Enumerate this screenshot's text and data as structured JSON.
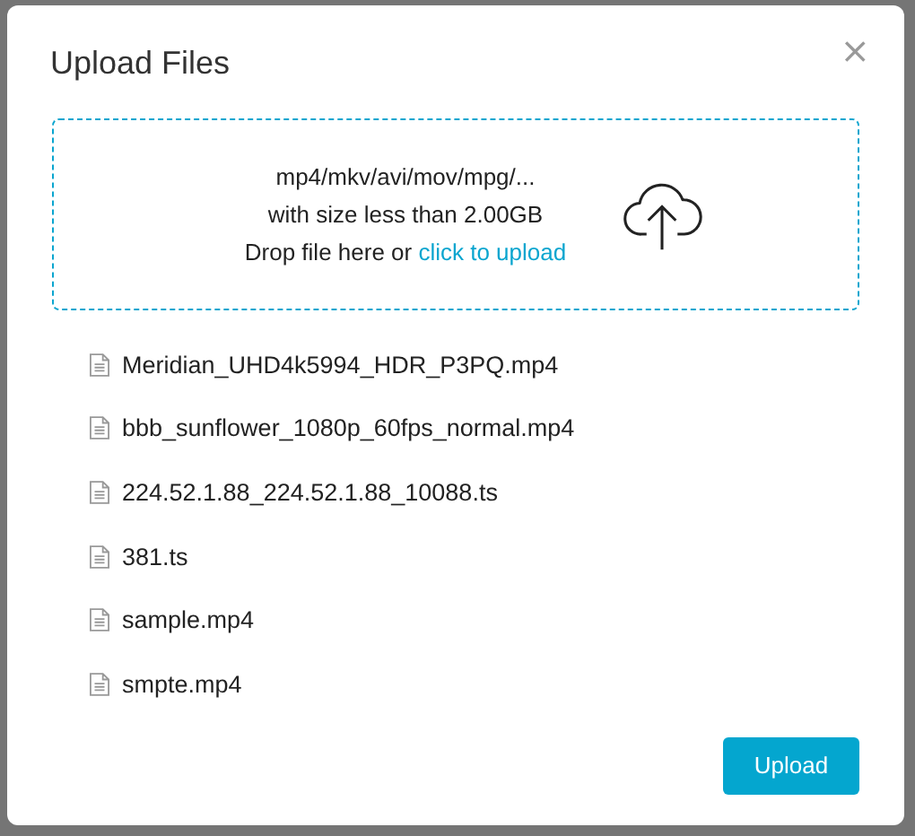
{
  "dialog": {
    "title": "Upload Files",
    "close": "×"
  },
  "drop_zone": {
    "formats": "mp4/mkv/avi/mov/mpg/...",
    "size_limit": "with size less than 2.00GB",
    "prompt": "Drop file here or",
    "link": "click to upload"
  },
  "files": [
    {
      "name": "Meridian_UHD4k5994_HDR_P3PQ.mp4"
    },
    {
      "name": "bbb_sunflower_1080p_60fps_normal.mp4"
    },
    {
      "name": "224.52.1.88_224.52.1.88_10088.ts"
    },
    {
      "name": "381.ts"
    },
    {
      "name": "sample.mp4"
    },
    {
      "name": "smpte.mp4"
    }
  ],
  "buttons": [
    {
      "label": "Upload",
      "kind": "primary"
    }
  ]
}
